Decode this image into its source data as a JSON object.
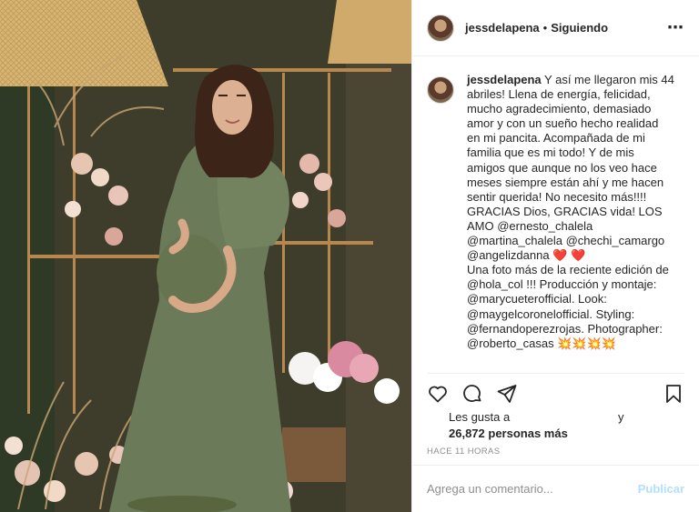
{
  "post": {
    "username": "jessdelapena",
    "follow_status": "Siguiendo",
    "separator": "•",
    "more_icon": "more-icon"
  },
  "caption": {
    "username": "jessdelapena",
    "lines": [
      "Y así me llegaron mis 44",
      "abriles! Llena de energía, felicidad,",
      "mucho agradecimiento, demasiado",
      "amor y con un sueño hecho realidad",
      "en mi pancita. Acompañada de mi",
      "familia que es mi todo! Y de mis",
      "amigos que aunque no los veo hace",
      "meses siempre están ahí y me hacen",
      "sentir querida! No necesito más!!!!",
      "GRACIAS Dios, GRACIAS vida! LOS",
      "AMO @ernesto_chalela",
      "@martina_chalela @chechi_camargo",
      "@angelizdanna ❤️ ❤️",
      "Una foto más de la reciente edición de",
      "@hola_col !!! Producción y montaje:",
      "@marycueterofficial. Look:",
      "@maygelcoronelofficial. Styling:",
      "@fernandoperezrojas. Photographer:",
      "@roberto_casas 💥💥💥💥"
    ]
  },
  "actions": {
    "like_icon": "heart-icon",
    "comment_icon": "comment-icon",
    "share_icon": "paper-plane-icon",
    "save_icon": "bookmark-icon"
  },
  "likes": {
    "prefix": "Les gusta a",
    "and": "y",
    "count_text": "26,872 personas más"
  },
  "timestamp": "HACE 11 HORAS",
  "comment_box": {
    "placeholder": "Agrega un comentario...",
    "publish_label": "Publicar"
  },
  "colors": {
    "dress": "#6b7a58",
    "publish_disabled": "#b2dffc",
    "muted": "#8e8e8e"
  }
}
